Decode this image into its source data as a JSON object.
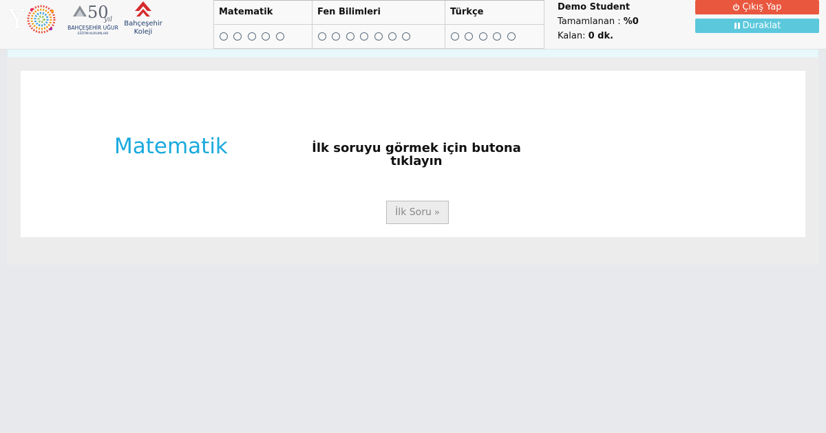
{
  "header": {
    "logos": [
      {
        "name": "spiral-logo",
        "text": "Y"
      },
      {
        "name": "bahcesehir-ugur-50-yil-logo",
        "text_big": "50",
        "text_small": "yıl",
        "line1": "BAHÇEŞEHİR UĞUR",
        "line2": "EĞİTİM KURUMLARI"
      },
      {
        "name": "bahcesehir-koleji-logo",
        "line1": "Bahçeşehir",
        "line2": "Koleji"
      }
    ],
    "subjects": [
      {
        "label": "Matematik",
        "questions": 5
      },
      {
        "label": "Fen Bilimleri",
        "questions": 7
      },
      {
        "label": "Türkçe",
        "questions": 5
      }
    ],
    "student": {
      "name": "Demo Student",
      "completed_label": "Tamamlanan :",
      "completed_value": "%0",
      "remaining_label": "Kalan:",
      "remaining_value": "0 dk."
    },
    "exit_label": "Çıkış Yap",
    "pause_label": "Duraklat"
  },
  "main": {
    "subject_title": "Matematik",
    "prompt": "İlk soruyu görmek için butona tıklayın",
    "first_button_label": "İlk Soru"
  },
  "colors": {
    "accent": "#19aadd",
    "exit": "#e9573f",
    "pause": "#5bc8dc"
  }
}
